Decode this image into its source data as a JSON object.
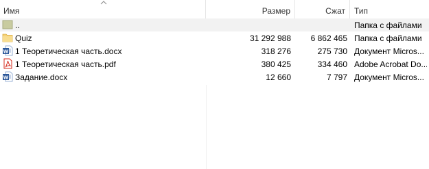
{
  "columns": {
    "name": "Имя",
    "size": "Размер",
    "packed": "Сжат",
    "type": "Тип"
  },
  "rows": [
    {
      "icon": "folder-up-icon",
      "name": "..",
      "size": "",
      "packed": "",
      "type": "Папка с файлами",
      "selected": true
    },
    {
      "icon": "folder-icon",
      "name": "Quiz",
      "size": "31 292 988",
      "packed": "6 862 465",
      "type": "Папка с файлами"
    },
    {
      "icon": "word-document-icon",
      "name": "1 Теоретическая часть.docx",
      "size": "318 276",
      "packed": "275 730",
      "type": "Документ Micros..."
    },
    {
      "icon": "pdf-document-icon",
      "name": "1 Теоретическая часть.pdf",
      "size": "380 425",
      "packed": "334 460",
      "type": "Adobe Acrobat Do..."
    },
    {
      "icon": "word-document-icon",
      "name": "Задание.docx",
      "size": "12 660",
      "packed": "7 797",
      "type": "Документ Micros..."
    }
  ],
  "colors": {
    "selected_row": "#f2f2f2",
    "folder": "#f5d37a",
    "word_blue": "#2b579a",
    "pdf_red": "#d52b1e"
  },
  "sort": {
    "column": "name",
    "direction": "ascending"
  }
}
